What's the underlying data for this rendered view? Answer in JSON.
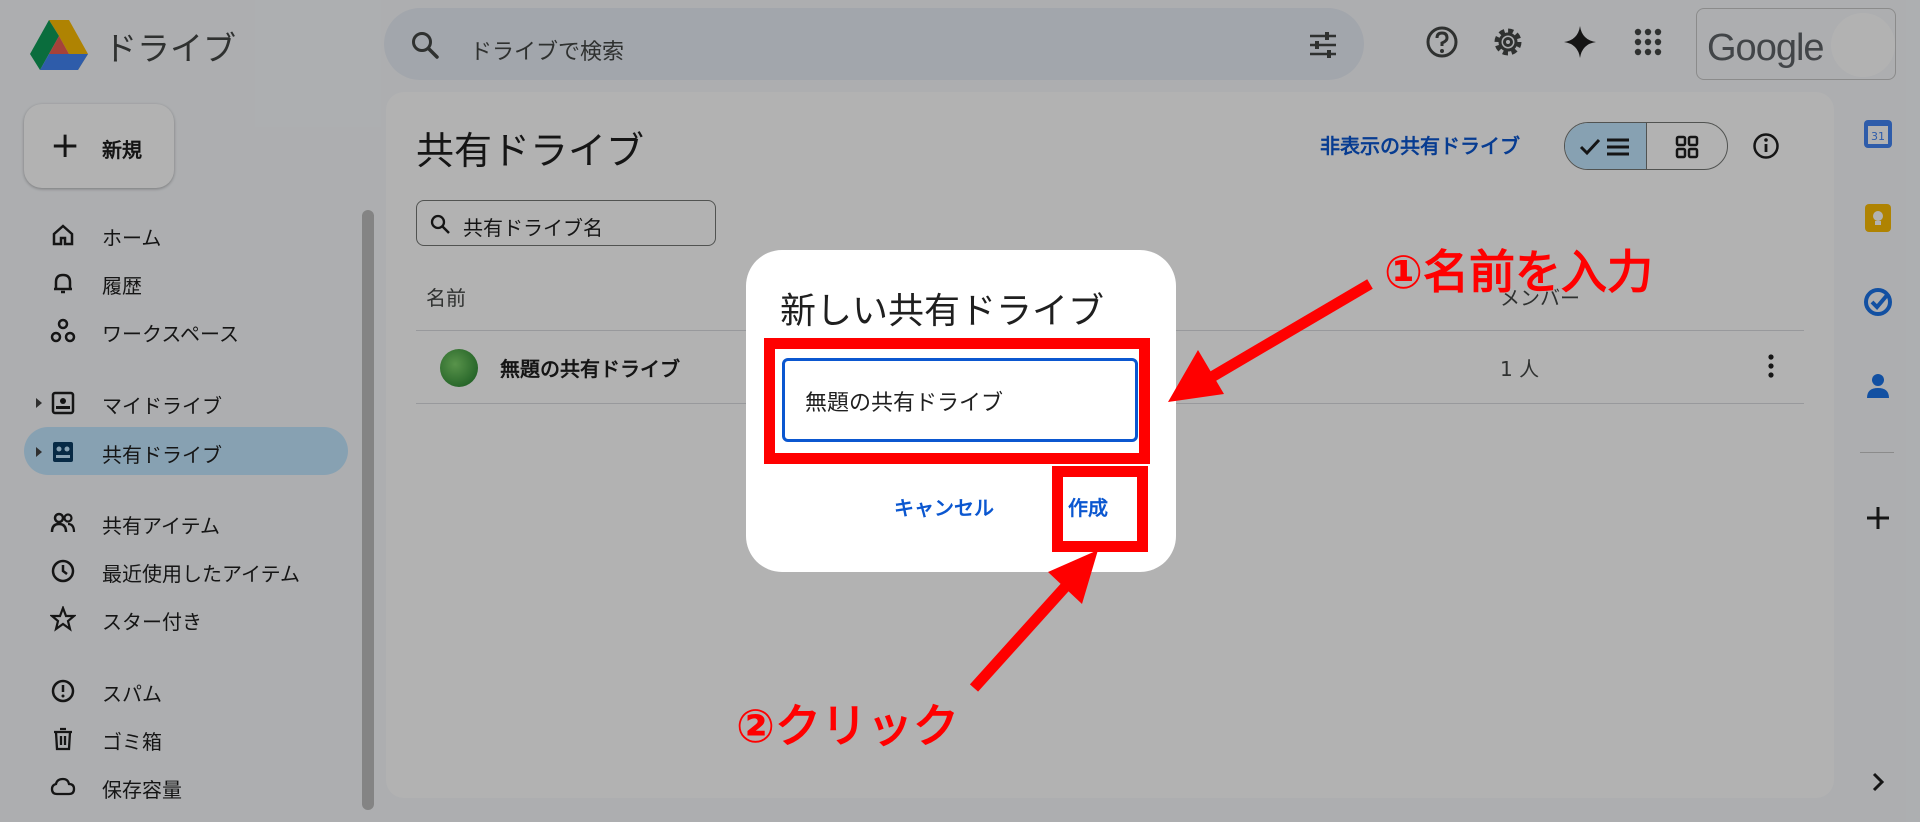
{
  "header": {
    "app_name": "ドライブ",
    "search_placeholder": "ドライブで検索",
    "account_brand": "Google"
  },
  "sidebar": {
    "new_label": "新規",
    "items": [
      {
        "label": "ホーム",
        "icon": "home-icon"
      },
      {
        "label": "履歴",
        "icon": "bell-icon"
      },
      {
        "label": "ワークスペース",
        "icon": "workspace-icon"
      },
      {
        "label": "マイドライブ",
        "icon": "my-drive-icon"
      },
      {
        "label": "共有ドライブ",
        "icon": "shared-drive-icon"
      },
      {
        "label": "共有アイテム",
        "icon": "people-icon"
      },
      {
        "label": "最近使用したアイテム",
        "icon": "clock-icon"
      },
      {
        "label": "スター付き",
        "icon": "star-icon"
      },
      {
        "label": "スパム",
        "icon": "spam-icon"
      },
      {
        "label": "ゴミ箱",
        "icon": "trash-icon"
      },
      {
        "label": "保存容量",
        "icon": "cloud-icon"
      }
    ]
  },
  "main": {
    "title": "共有ドライブ",
    "hidden_link": "非表示の共有ドライブ",
    "filter_placeholder": "共有ドライブ名",
    "columns": {
      "name": "名前",
      "members": "メンバー"
    },
    "rows": [
      {
        "name": "無題の共有ドライブ",
        "members": "1 人"
      }
    ]
  },
  "dialog": {
    "title": "新しい共有ドライブ",
    "input_value": "無題の共有ドライブ",
    "cancel_label": "キャンセル",
    "create_label": "作成"
  },
  "annotations": {
    "step1": "①名前を入力",
    "step2": "②クリック"
  },
  "colors": {
    "accent": "#0b57d0",
    "active_nav": "#c2e7ff",
    "annotation_red": "#ff0000"
  }
}
